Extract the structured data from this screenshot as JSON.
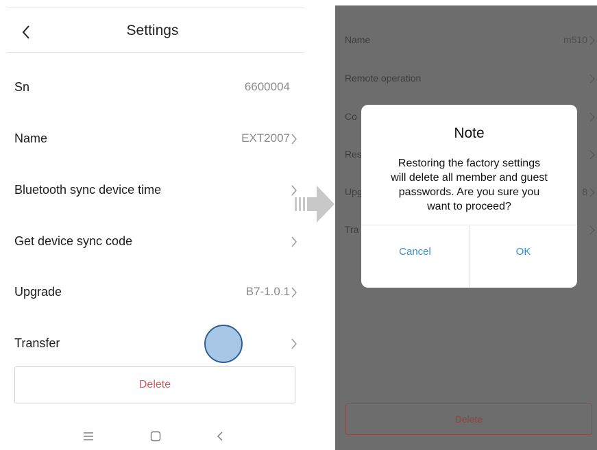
{
  "left": {
    "header": {
      "title": "Settings"
    },
    "rows": [
      {
        "label": "Sn",
        "value": "6600004"
      },
      {
        "label": "Name",
        "value": "EXT2007"
      },
      {
        "label": "Bluetooth sync device time",
        "value": ""
      },
      {
        "label": "Get device sync code",
        "value": ""
      },
      {
        "label": "Upgrade",
        "value": "B7-1.0.1"
      },
      {
        "label": "Transfer",
        "value": ""
      }
    ],
    "delete_label": "Delete",
    "navbar": {
      "icons": [
        "menu-icon",
        "home-icon",
        "back-icon"
      ]
    }
  },
  "right": {
    "rows": [
      {
        "label": "Name",
        "value": "m510"
      },
      {
        "label": "Remote operation",
        "value": ""
      },
      {
        "label": "Co",
        "value": ""
      },
      {
        "label": "Res",
        "value": ""
      },
      {
        "label": "Upg",
        "value": "8"
      },
      {
        "label": "Tra",
        "value": ""
      }
    ],
    "delete_label": "Delete",
    "dialog": {
      "title": "Note",
      "message_lines": [
        "Restoring the factory settings",
        "will delete all member and guest",
        "passwords. Are you sure you",
        "want to proceed?"
      ],
      "cancel_label": "Cancel",
      "ok_label": "OK"
    }
  },
  "colors": {
    "delete_text": "#d85a5a",
    "dialog_button_text": "#3b8fcf",
    "overlay": "#6d6d6d",
    "touch_indicator_fill": "#a8c7e6",
    "touch_indicator_border": "#2f5f93"
  }
}
